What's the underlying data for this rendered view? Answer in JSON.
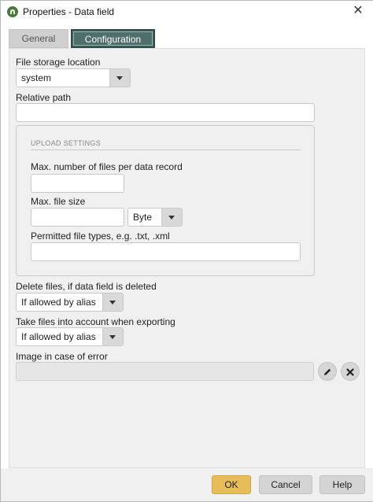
{
  "window": {
    "title": "Properties - Data field",
    "close_glyph": "✕"
  },
  "tabs": [
    {
      "label": "General",
      "active": false
    },
    {
      "label": "Configuration",
      "active": true
    }
  ],
  "form": {
    "file_storage_location": {
      "label": "File storage location",
      "value": "system"
    },
    "relative_path": {
      "label": "Relative path",
      "value": ""
    },
    "upload_settings": {
      "title": "UPLOAD SETTINGS",
      "max_files": {
        "label": "Max. number of files per data record",
        "value": ""
      },
      "max_file_size": {
        "label": "Max. file size",
        "value": "",
        "unit": "Byte"
      },
      "permitted_types": {
        "label": "Permitted file types, e.g. .txt, .xml",
        "value": ""
      }
    },
    "delete_files": {
      "label": "Delete files, if data field is deleted",
      "value": "If allowed by alias"
    },
    "take_files_export": {
      "label": "Take files into account when exporting",
      "value": "If allowed by alias"
    },
    "image_on_error": {
      "label": "Image in case of error",
      "value": "",
      "edit_icon": "pencil-icon",
      "clear_icon": "close-icon"
    }
  },
  "footer": {
    "ok_label": "OK",
    "cancel_label": "Cancel",
    "help_label": "Help"
  },
  "colors": {
    "accent_ok": "#e7bc5a",
    "active_tab": "#4f6f6a",
    "app_icon": "#4a7a3a"
  }
}
